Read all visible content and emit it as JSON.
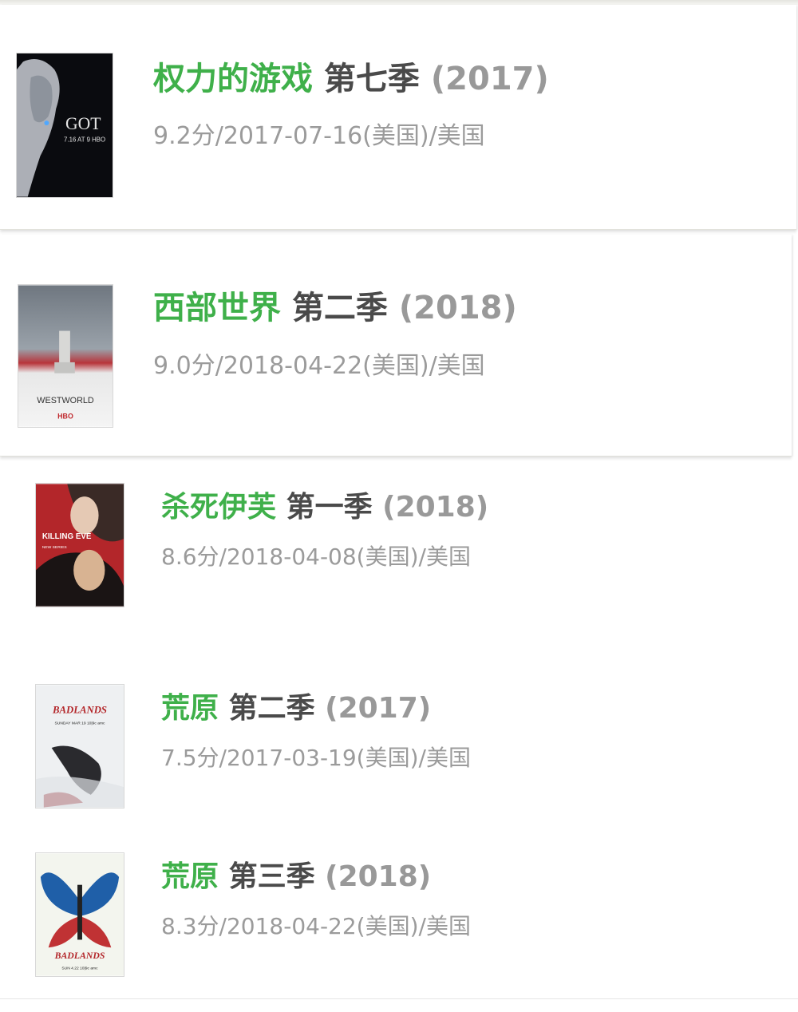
{
  "items": [
    {
      "name": "权力的游戏",
      "season": "第七季",
      "year": "(2017)",
      "meta": "9.2分/2017-07-16(美国)/美国",
      "poster_text": "GOT",
      "poster_sub": "7.16 AT 9 HBO"
    },
    {
      "name": "西部世界",
      "season": "第二季",
      "year": "(2018)",
      "meta": "9.0分/2018-04-22(美国)/美国",
      "poster_text": "WESTWORLD",
      "poster_sub": "HBO"
    },
    {
      "name": "杀死伊芙",
      "season": "第一季",
      "year": "(2018)",
      "meta": "8.6分/2018-04-08(美国)/美国",
      "poster_text": "KILLING EVE",
      "poster_sub": "NEW SERIES"
    },
    {
      "name": "荒原",
      "season": "第二季",
      "year": "(2017)",
      "meta": "7.5分/2017-03-19(美国)/美国",
      "poster_text": "BADLANDS",
      "poster_sub": "SUNDAY MAR 19 10|9c amc"
    },
    {
      "name": "荒原",
      "season": "第三季",
      "year": "(2018)",
      "meta": "8.3分/2018-04-22(美国)/美国",
      "poster_text": "BADLANDS",
      "poster_sub": "SUN 4.22 10|9c amc"
    }
  ],
  "colors": {
    "title_green": "#3fb04a",
    "season_dark": "#4a4a4a",
    "meta_gray": "#9b9b9b"
  }
}
